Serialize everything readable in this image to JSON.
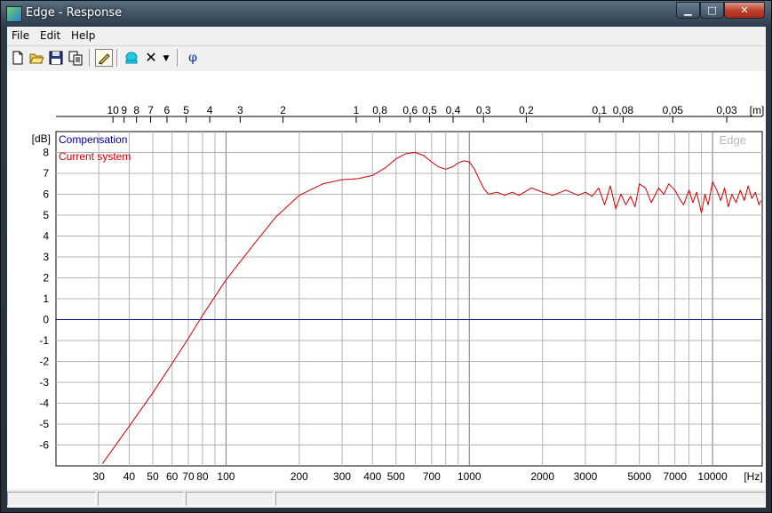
{
  "window": {
    "title": "Edge - Response"
  },
  "menu": [
    "File",
    "Edit",
    "Help"
  ],
  "toolbar": {
    "icons": [
      "new-document",
      "open-folder",
      "save-disk",
      "copy",
      "pencil-edit",
      "blob",
      "delete-x",
      "dropdown-arrow",
      "phi"
    ],
    "phi_label": "φ"
  },
  "chart_data": {
    "type": "line",
    "x_scale": "log",
    "xlim": [
      20,
      16000
    ],
    "ylim": [
      -7,
      9
    ],
    "xlabel": "[Hz]",
    "ylabel": "[dB]",
    "top_axis_label": "[m]",
    "watermark": "Edge",
    "x_ticks": [
      30,
      40,
      50,
      60,
      70,
      80,
      100,
      200,
      300,
      400,
      500,
      700,
      1000,
      2000,
      3000,
      5000,
      7000,
      10000
    ],
    "x_tick_labels": [
      "30",
      "40",
      "50",
      "60",
      "70",
      "80",
      "100",
      "200",
      "300",
      "400",
      "500",
      "700",
      "1000",
      "2000",
      "3000",
      "5000",
      "7000",
      "10000"
    ],
    "y_ticks": [
      -6,
      -5,
      -4,
      -3,
      -2,
      -1,
      0,
      1,
      2,
      3,
      4,
      5,
      6,
      7,
      8
    ],
    "top_ticks": [
      {
        "label": "10",
        "m": 10
      },
      {
        "label": "9",
        "m": 9
      },
      {
        "label": "8",
        "m": 8
      },
      {
        "label": "7",
        "m": 7
      },
      {
        "label": "6",
        "m": 6
      },
      {
        "label": "5",
        "m": 5
      },
      {
        "label": "4",
        "m": 4
      },
      {
        "label": "3",
        "m": 3
      },
      {
        "label": "2",
        "m": 2
      },
      {
        "label": "1",
        "m": 1
      },
      {
        "label": "0,8",
        "m": 0.8
      },
      {
        "label": "0,6",
        "m": 0.6
      },
      {
        "label": "0,5",
        "m": 0.5
      },
      {
        "label": "0,4",
        "m": 0.4
      },
      {
        "label": "0,3",
        "m": 0.3
      },
      {
        "label": "0,2",
        "m": 0.2
      },
      {
        "label": "0,1",
        "m": 0.1
      },
      {
        "label": "0,08",
        "m": 0.08
      },
      {
        "label": "0,05",
        "m": 0.05
      },
      {
        "label": "0,03",
        "m": 0.03
      }
    ],
    "series": [
      {
        "name": "Compensation",
        "color": "#00008b",
        "x": [
          20,
          16000
        ],
        "y": [
          0,
          0
        ]
      },
      {
        "name": "Current system",
        "color": "#cc0000",
        "x": [
          31,
          40,
          50,
          60,
          70,
          80,
          100,
          130,
          160,
          200,
          250,
          300,
          350,
          400,
          450,
          500,
          550,
          600,
          650,
          700,
          750,
          800,
          850,
          900,
          950,
          1000,
          1050,
          1100,
          1150,
          1200,
          1300,
          1400,
          1500,
          1600,
          1800,
          2000,
          2200,
          2500,
          2800,
          3000,
          3200,
          3400,
          3600,
          3800,
          4000,
          4200,
          4400,
          4600,
          4800,
          5000,
          5300,
          5600,
          6000,
          6300,
          6600,
          7000,
          7300,
          7600,
          8000,
          8300,
          8600,
          9000,
          9300,
          9600,
          10000,
          10400,
          10800,
          11200,
          11600,
          12000,
          12500,
          13000,
          13500,
          14000,
          14500,
          15000,
          15500,
          15800
        ],
        "y": [
          -6.9,
          -5.1,
          -3.5,
          -2.1,
          -0.9,
          0.2,
          1.9,
          3.6,
          4.9,
          5.95,
          6.5,
          6.7,
          6.75,
          6.9,
          7.25,
          7.7,
          7.95,
          8.0,
          7.85,
          7.55,
          7.3,
          7.2,
          7.3,
          7.5,
          7.6,
          7.55,
          7.2,
          6.7,
          6.25,
          6.0,
          6.1,
          5.95,
          6.1,
          5.95,
          6.3,
          6.1,
          5.95,
          6.2,
          5.95,
          6.1,
          5.9,
          6.3,
          5.5,
          6.4,
          5.3,
          6.0,
          5.5,
          5.9,
          5.4,
          6.5,
          6.3,
          5.6,
          6.3,
          6.0,
          6.5,
          6.2,
          5.8,
          5.5,
          6.2,
          5.6,
          6.1,
          5.1,
          6.0,
          5.5,
          6.6,
          6.2,
          5.7,
          6.3,
          5.4,
          6.0,
          5.6,
          6.2,
          5.7,
          6.4,
          5.8,
          6.1,
          5.5,
          5.7
        ]
      }
    ]
  },
  "statusbar": {
    "panes": [
      "",
      "",
      "",
      ""
    ]
  }
}
